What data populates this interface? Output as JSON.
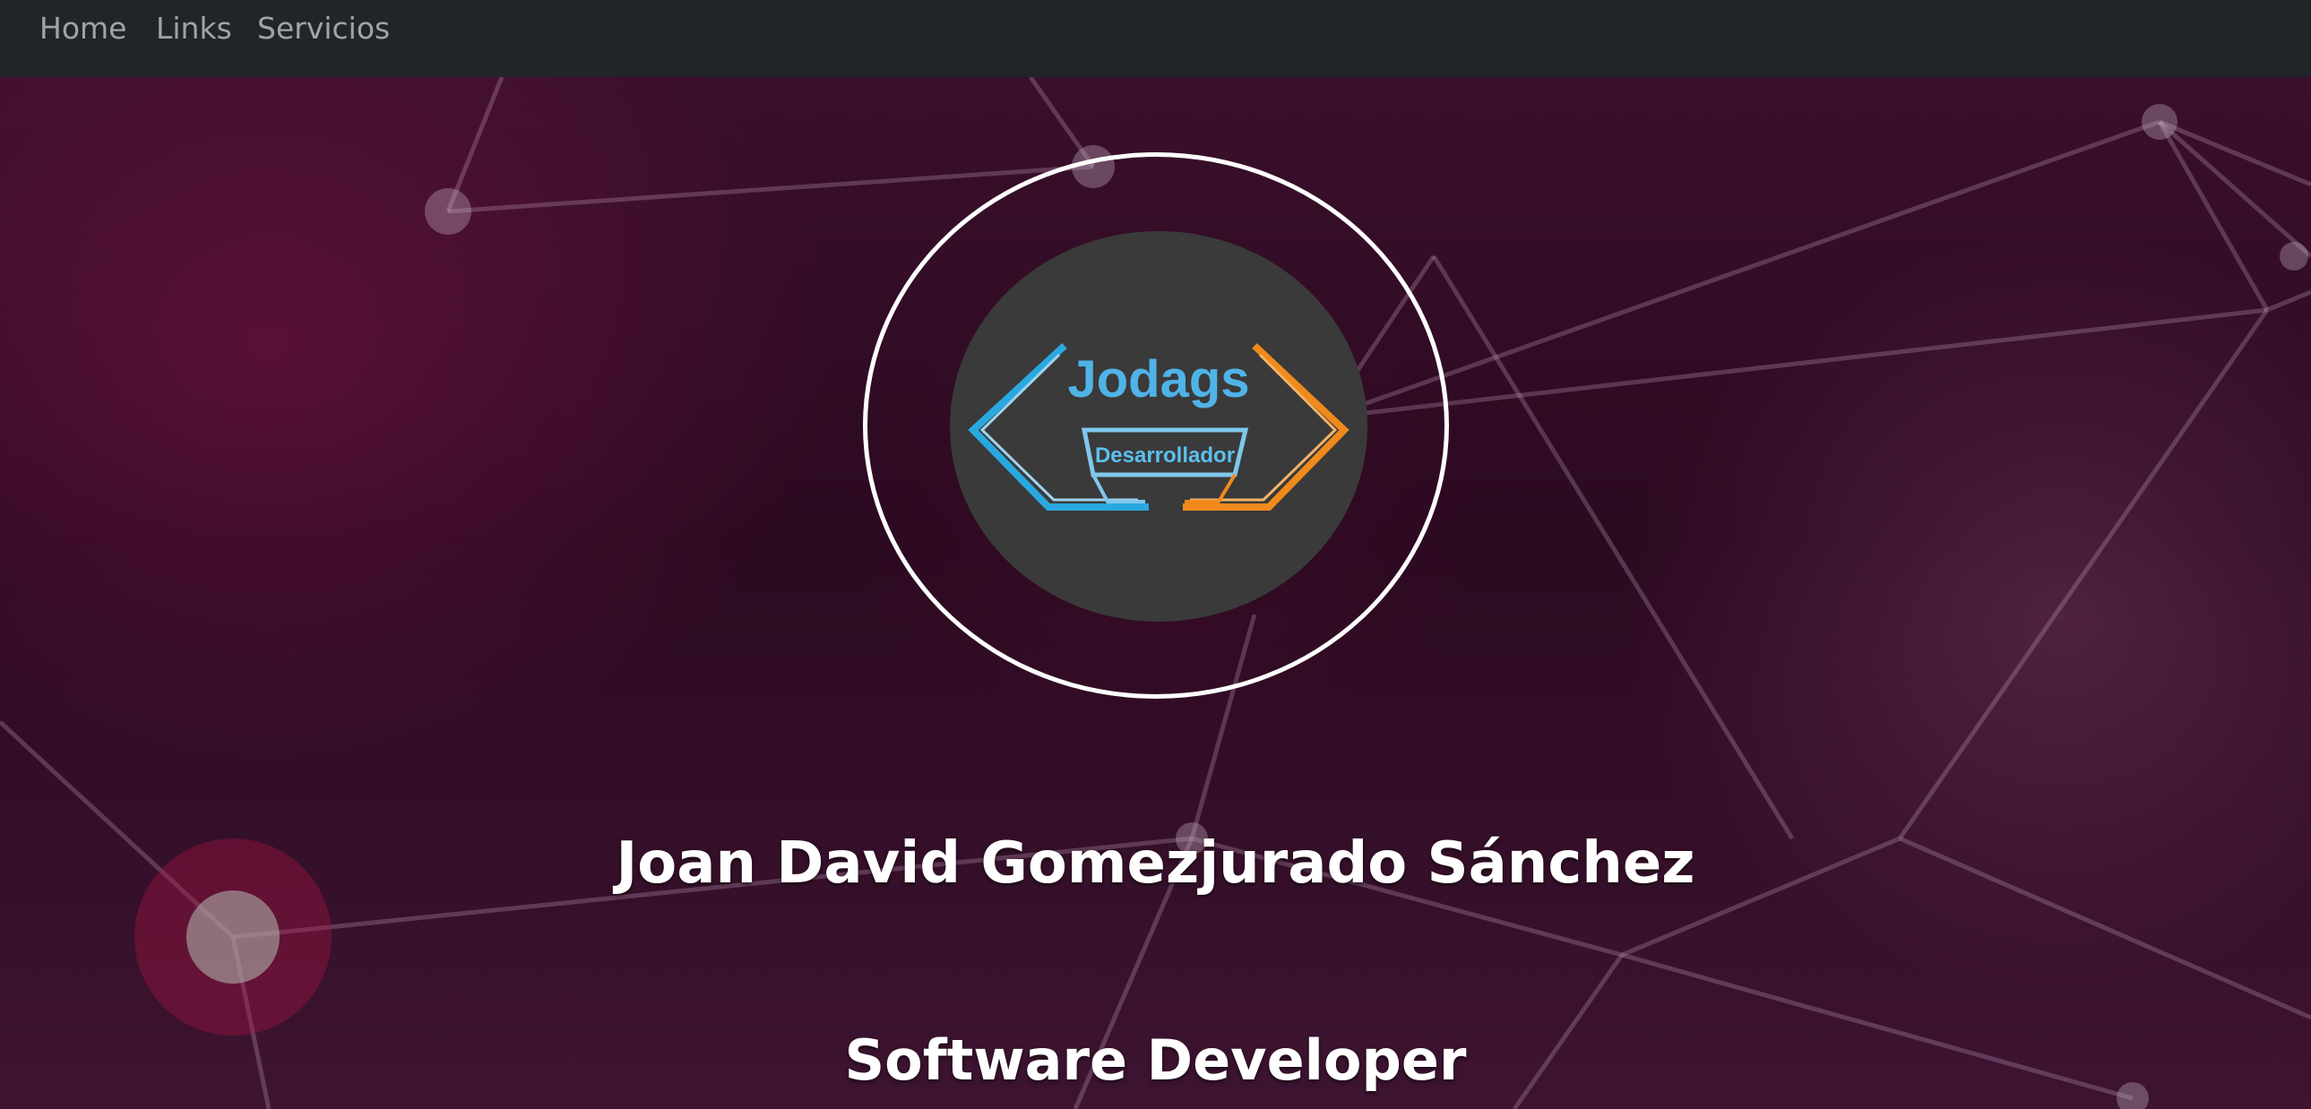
{
  "nav": {
    "items": [
      {
        "label": "Home"
      },
      {
        "label": "Links"
      },
      {
        "label": "Servicios"
      }
    ]
  },
  "hero": {
    "logo": {
      "brand": "Jodags",
      "subtitle": "Desarrollador",
      "colors": {
        "left_bracket": "#29a8e0",
        "right_bracket": "#f08a1c",
        "brand_text": "#3fa9e6",
        "disc": "#3a3a3a"
      }
    },
    "name": "Joan David Gomezjurado Sánchez",
    "role": "Software Developer"
  },
  "theme": {
    "navbar_bg": "#212529",
    "hero_bg": "#2b0a20",
    "accent": "#ffffff"
  }
}
